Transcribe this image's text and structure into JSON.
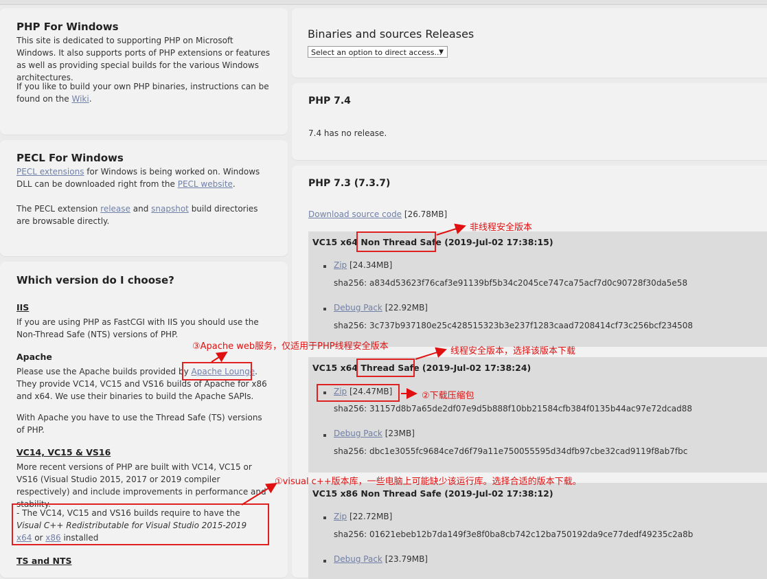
{
  "left": {
    "php_windows": {
      "title": "PHP For Windows",
      "p1": "This site is dedicated to supporting PHP on Microsoft Windows. It also supports ports of PHP extensions or features as well as providing special builds for the various Windows architectures.",
      "p2_pre": "If you like to build your own PHP binaries, instructions can be found on the ",
      "p2_link": "Wiki",
      "p2_post": "."
    },
    "pecl": {
      "title": "PECL For Windows",
      "link1": "PECL extensions",
      "t1": " for Windows is being worked on. Windows DLL can be downloaded right from the ",
      "link2": "PECL website",
      "t2": ".",
      "t3_pre": "The PECL extension ",
      "link3": "release",
      "t3_mid": " and ",
      "link4": "snapshot",
      "t3_post": " build directories are browsable directly."
    },
    "which": {
      "title": "Which version do I choose?",
      "iis_h": "IIS",
      "iis_t": "If you are using PHP as FastCGI with IIS you should use the Non-Thread Safe (NTS) versions of PHP.",
      "apache_h": "Apache",
      "apache_pre": "Please use the Apache builds provided by ",
      "apache_link": "Apache Lounge",
      "apache_post": ". They provide VC14, VC15 and VS16 builds of Apache for x86 and x64. We use their binaries to build the Apache SAPIs.",
      "apache_ts": "With Apache you have to use the Thread Safe (TS) versions of PHP.",
      "vc_h": "VC14, VC15 & VS16",
      "vc_t": "More recent versions of PHP are built with VC14, VC15 or VS16 (Visual Studio 2015, 2017 or 2019 compiler respectively) and include improvements in performance and stability.",
      "redist_pre": "- The VC14, VC15 and VS16 builds require to have the ",
      "redist_em": "Visual C++ Redistributable for Visual Studio 2015-2019",
      "redist_x64": "x64",
      "redist_or": " or ",
      "redist_x86": "x86",
      "redist_post": " installed",
      "ts_h": "TS and NTS"
    }
  },
  "right": {
    "releases_title": "Binaries and sources Releases",
    "select_placeholder": "Select an option to direct access...",
    "php74": {
      "title": "PHP 7.4",
      "note": "7.4 has no release."
    },
    "php73": {
      "title": "PHP 7.3 (7.3.7)",
      "source_link": "Download source code",
      "source_size": " [26.78MB]",
      "builds": [
        {
          "head_pre": "VC15 x64 ",
          "head_mid": "Non Thread Safe",
          "head_post": " (2019-Jul-02 17:38:15)",
          "zip": "Zip",
          "zip_size": " [24.34MB]",
          "zip_sha": "sha256: a834d53623f76caf3e91139bf5b34c2045ce747ca75acf7d0c90728f30da5e58",
          "debug": "Debug Pack",
          "debug_size": " [22.92MB]",
          "debug_sha": "sha256: 3c737b937180e25c428515323b3e237f1283caad7208414cf73c256bcf234508"
        },
        {
          "head_pre": "VC15 x64 ",
          "head_mid": "Thread Safe",
          "head_post": " (2019-Jul-02 17:38:24)",
          "zip": "Zip",
          "zip_size": " [24.47MB]",
          "zip_sha": "sha256: 31157d8b7a65de2df07e9d5b888f10bb21584cfb384f0135b44ac97e72dcad88",
          "debug": "Debug Pack",
          "debug_size": " [23MB]",
          "debug_sha": "sha256: dbc1e3055fc9684ce7d6f79a11e750055595d34dfb97cbe32cad9119f8ab7fbc"
        },
        {
          "head_pre": "VC15 x86 Non Thread Safe",
          "head_mid": "",
          "head_post": " (2019-Jul-02 17:38:12)",
          "zip": "Zip",
          "zip_size": " [22.72MB]",
          "zip_sha": "sha256: 01621ebeb12b7da149f3e8f0ba8cb742c12ba750192da9ce77dedf49235c2a8b",
          "debug": "Debug Pack",
          "debug_size": " [23.79MB]"
        }
      ]
    }
  },
  "annotations": {
    "nts": "非线程安全版本",
    "ts": "线程安全版本，选择该版本下载",
    "zip": "②下载压缩包",
    "apache": "③Apache web服务，仅适用于PHP线程安全版本",
    "vc": "①visual c++版本库，一些电脑上可能缺少该运行库。选择合适的版本下载。"
  },
  "colors": {
    "annotation": "#e01010",
    "link": "#6f7fa8"
  }
}
